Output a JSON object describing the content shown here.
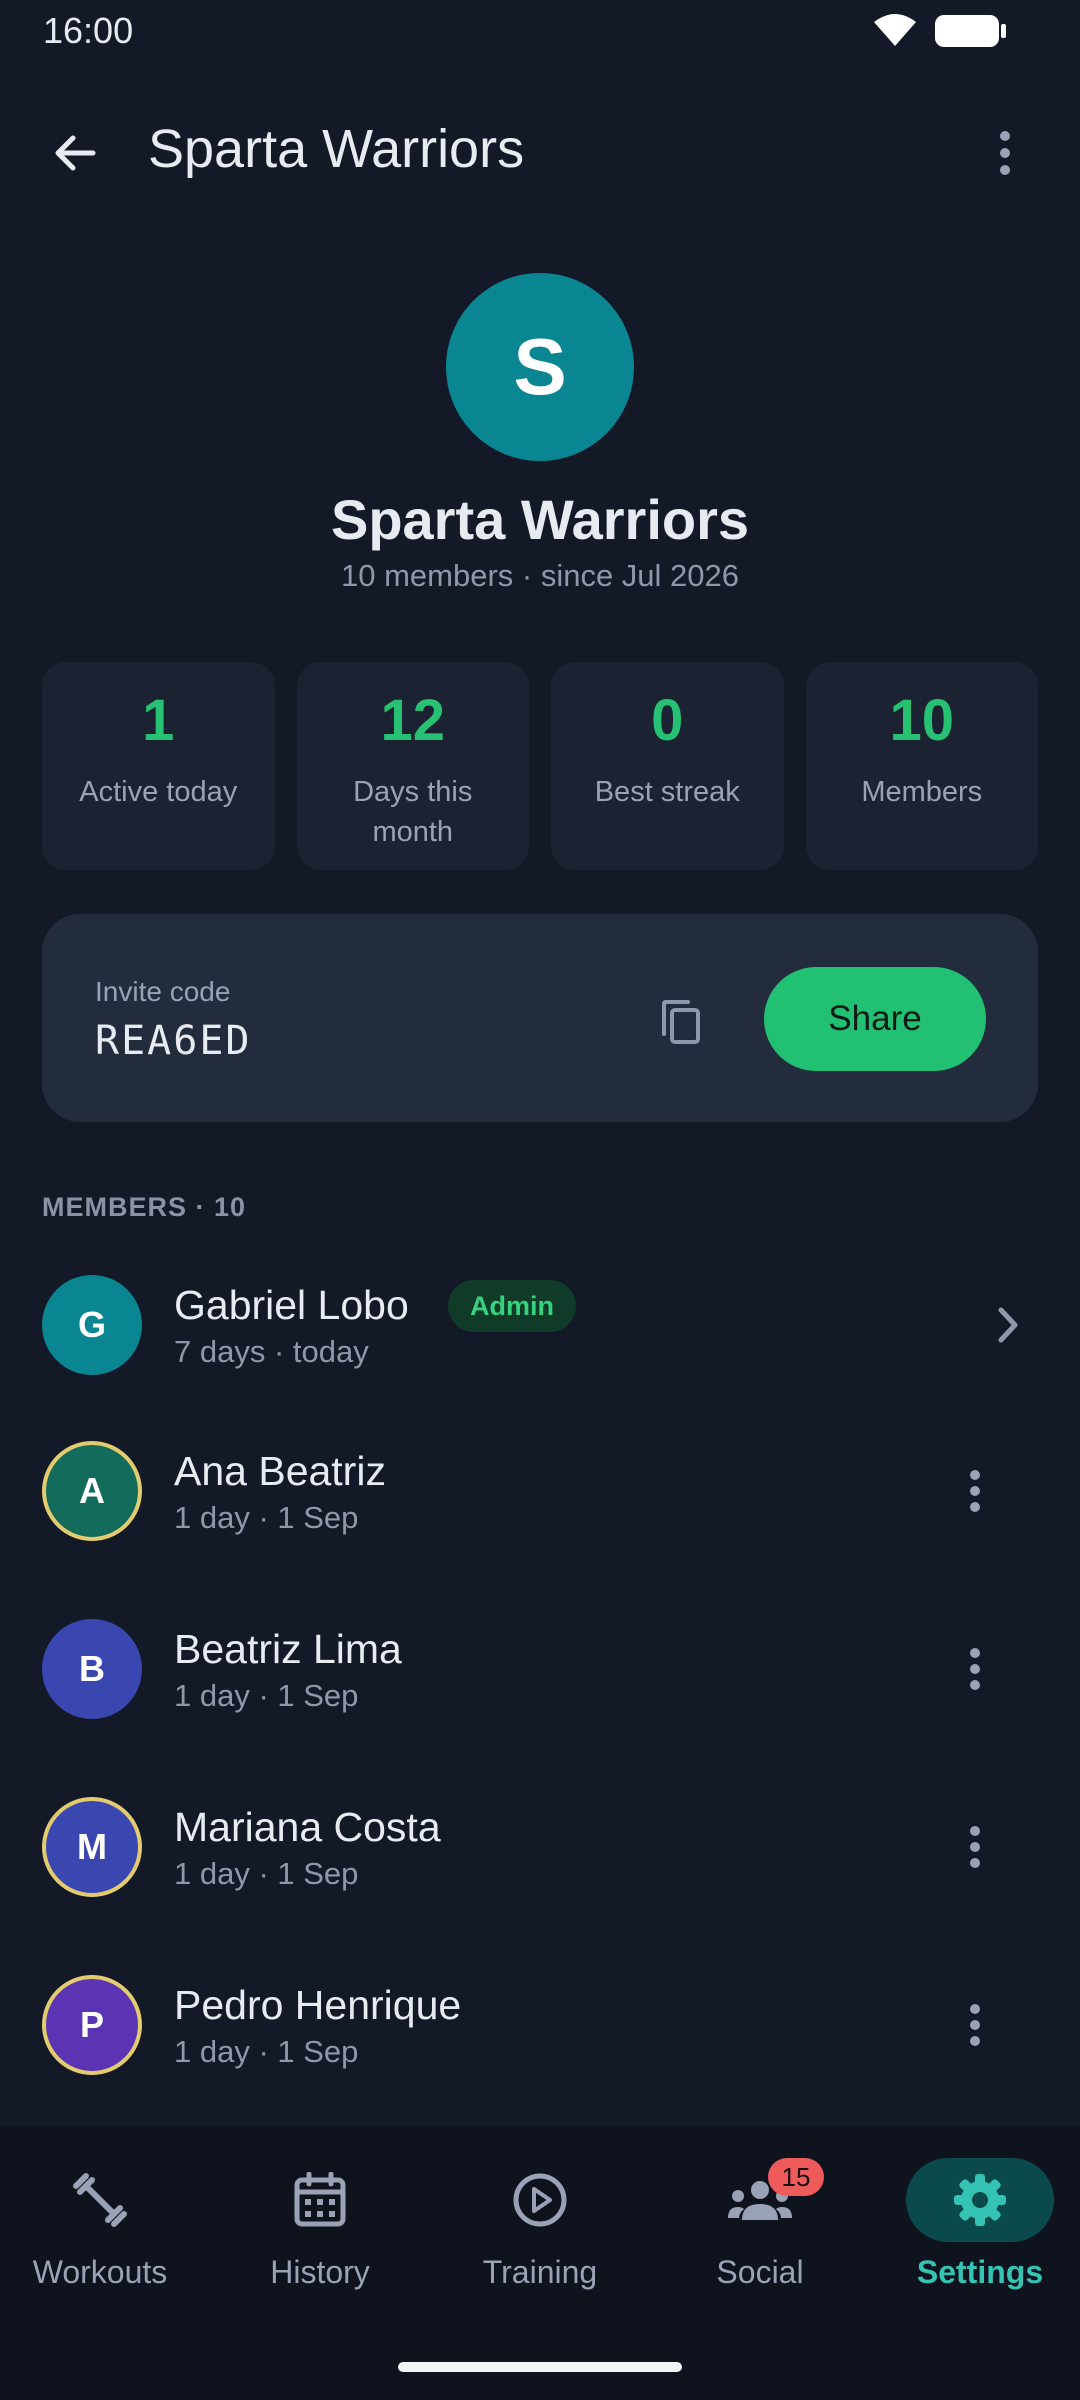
{
  "status_bar": {
    "time": "16:00"
  },
  "app_bar": {
    "title": "Sparta Warriors"
  },
  "group": {
    "initial": "S",
    "name": "Sparta Warriors",
    "meta": "10 members · since Jul 2026"
  },
  "stats": [
    {
      "value": "1",
      "label": "Active today"
    },
    {
      "value": "12",
      "label": "Days this month"
    },
    {
      "value": "0",
      "label": "Best streak"
    },
    {
      "value": "10",
      "label": "Members"
    }
  ],
  "invite": {
    "label": "Invite code",
    "code": "REA6ED",
    "share_label": "Share"
  },
  "members_section": {
    "label": "MEMBERS · 10"
  },
  "members": [
    {
      "initial": "G",
      "name": "Gabriel Lobo",
      "sub": "7 days · today",
      "badge": "Admin",
      "color": "#098691"
    },
    {
      "initial": "A",
      "name": "Ana Beatriz",
      "sub": "1 day · 1 Sep",
      "color": "#126b5b"
    },
    {
      "initial": "B",
      "name": "Beatriz Lima",
      "sub": "1 day · 1 Sep",
      "color": "#3b47b1"
    },
    {
      "initial": "M",
      "name": "Mariana Costa",
      "sub": "1 day · 1 Sep",
      "color": "#3b47b1"
    },
    {
      "initial": "P",
      "name": "Pedro Henrique",
      "sub": "1 day · 1 Sep",
      "color": "#5b34b3"
    }
  ],
  "nav": [
    {
      "label": "Workouts",
      "icon": "dumbbell-icon"
    },
    {
      "label": "History",
      "icon": "calendar-icon"
    },
    {
      "label": "Training",
      "icon": "play-circle-icon"
    },
    {
      "label": "Social",
      "icon": "group-icon",
      "badge": "15"
    },
    {
      "label": "Settings",
      "icon": "gear-icon",
      "active": true
    }
  ],
  "colors": {
    "accent": "#22c072",
    "teal": "#35c3b3",
    "background": "#131926",
    "badge": "#ef5b5b"
  }
}
